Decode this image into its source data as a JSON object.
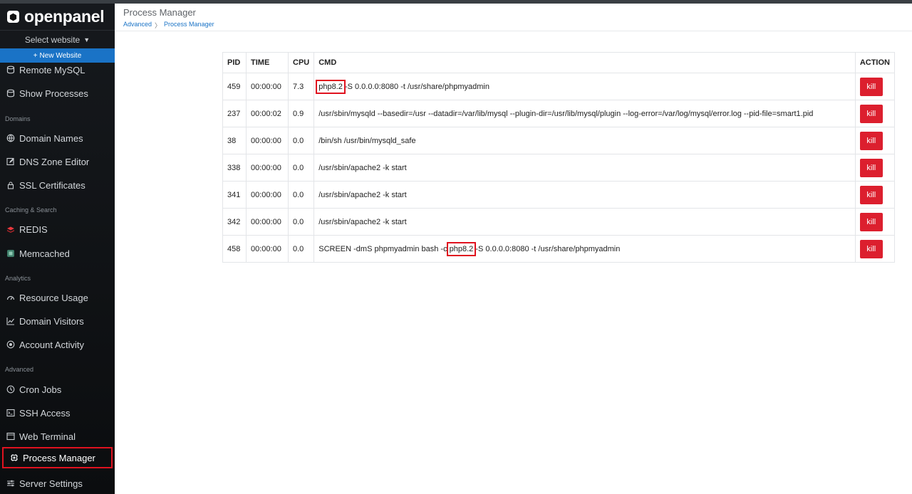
{
  "app": {
    "name": "openpanel"
  },
  "sidebar": {
    "select_website": "Select website",
    "new_website": "New Website",
    "items": [
      {
        "label": "Remote MySQL",
        "icon": "database-icon"
      },
      {
        "label": "Show Processes",
        "icon": "database-icon"
      },
      {
        "label": "Domains",
        "section": true
      },
      {
        "label": "Domain Names",
        "icon": "globe-icon"
      },
      {
        "label": "DNS Zone Editor",
        "icon": "edit-icon"
      },
      {
        "label": "SSL Certificates",
        "icon": "lock-icon"
      },
      {
        "label": "Caching & Search",
        "section": true
      },
      {
        "label": "REDIS",
        "icon": "redis-icon"
      },
      {
        "label": "Memcached",
        "icon": "memcached-icon"
      },
      {
        "label": "Analytics",
        "section": true
      },
      {
        "label": "Resource Usage",
        "icon": "gauge-icon"
      },
      {
        "label": "Domain Visitors",
        "icon": "chart-icon"
      },
      {
        "label": "Account Activity",
        "icon": "activity-icon"
      },
      {
        "label": "Advanced",
        "section": true
      },
      {
        "label": "Cron Jobs",
        "icon": "clock-icon"
      },
      {
        "label": "SSH Access",
        "icon": "terminal-icon"
      },
      {
        "label": "Web Terminal",
        "icon": "web-terminal-icon"
      },
      {
        "label": "Process Manager",
        "icon": "cpu-icon",
        "active": true
      },
      {
        "label": "Server Settings",
        "icon": "sliders-icon"
      }
    ]
  },
  "header": {
    "title": "Process Manager",
    "breadcrumb": [
      "Advanced",
      "Process Manager"
    ]
  },
  "table": {
    "columns": [
      "PID",
      "TIME",
      "CPU",
      "CMD",
      "ACTION"
    ],
    "kill_label": "kill",
    "rows": [
      {
        "pid": "459",
        "time": "00:00:00",
        "cpu": "7.3",
        "cmd_pre": "",
        "cmd_hl": "php8.2",
        "cmd_post": " -S 0.0.0.0:8080 -t /usr/share/phpmyadmin"
      },
      {
        "pid": "237",
        "time": "00:00:02",
        "cpu": "0.9",
        "cmd": "/usr/sbin/mysqld --basedir=/usr --datadir=/var/lib/mysql --plugin-dir=/usr/lib/mysql/plugin --log-error=/var/log/mysql/error.log --pid-file=smart1.pid"
      },
      {
        "pid": "38",
        "time": "00:00:00",
        "cpu": "0.0",
        "cmd": "/bin/sh /usr/bin/mysqld_safe"
      },
      {
        "pid": "338",
        "time": "00:00:00",
        "cpu": "0.0",
        "cmd": "/usr/sbin/apache2 -k start"
      },
      {
        "pid": "341",
        "time": "00:00:00",
        "cpu": "0.0",
        "cmd": "/usr/sbin/apache2 -k start"
      },
      {
        "pid": "342",
        "time": "00:00:00",
        "cpu": "0.0",
        "cmd": "/usr/sbin/apache2 -k start"
      },
      {
        "pid": "458",
        "time": "00:00:00",
        "cpu": "0.0",
        "cmd_pre": "SCREEN -dmS phpmyadmin bash -c ",
        "cmd_hl": "php8.2",
        "cmd_post": " -S 0.0.0.0:8080 -t /usr/share/phpmyadmin"
      }
    ]
  },
  "colors": {
    "accent": "#1a73c6",
    "danger": "#dc1f2e",
    "highlight": "#e0121f",
    "sidebar_bg": "#16191d"
  }
}
